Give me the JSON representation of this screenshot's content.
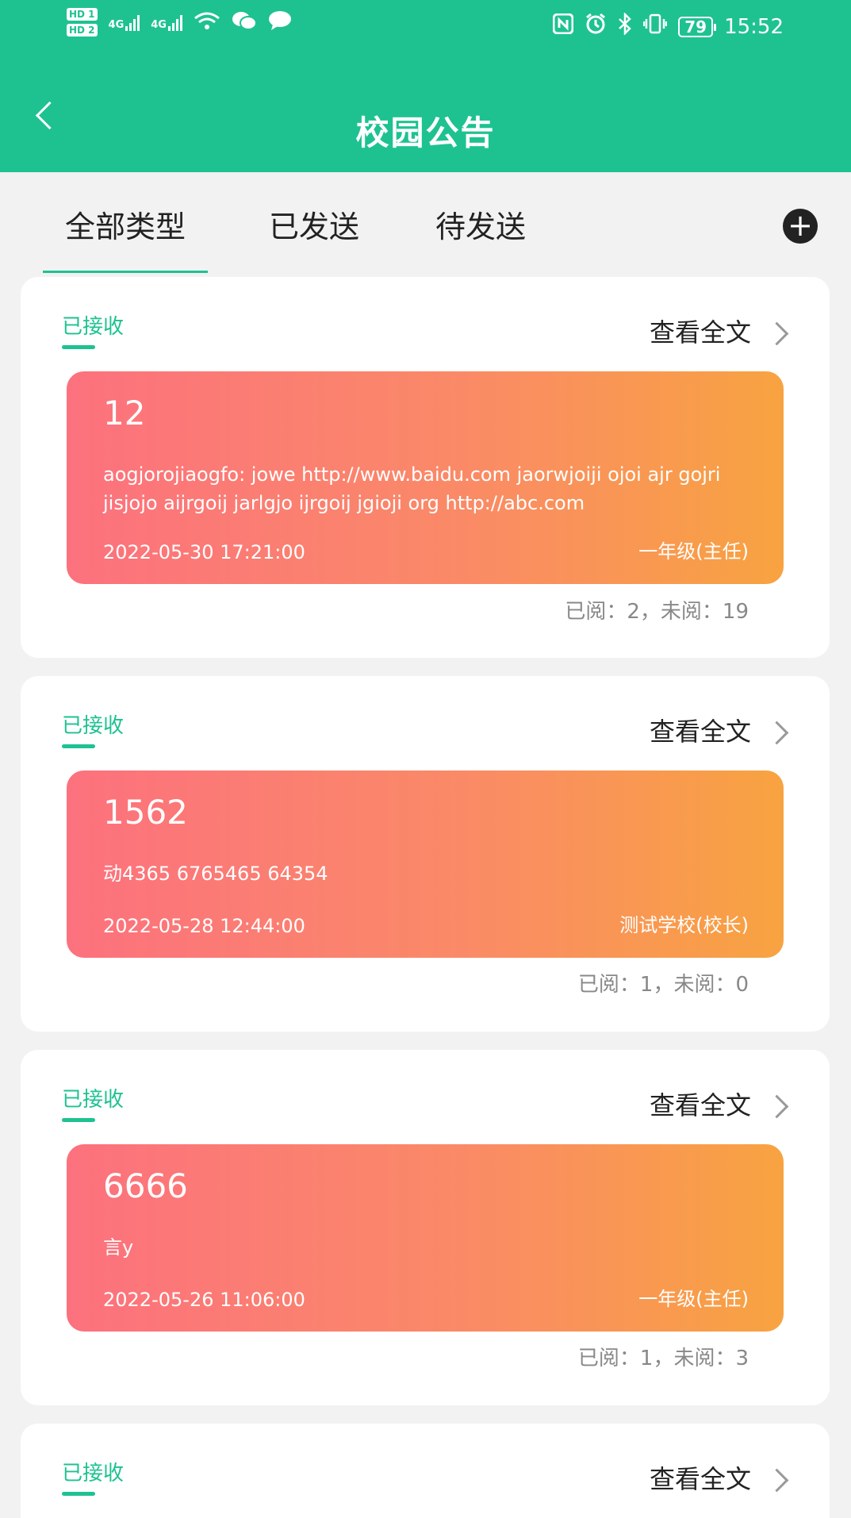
{
  "status_bar": {
    "hd1": "HD 1",
    "hd2": "HD 2",
    "net1": "4G",
    "net2": "4G",
    "battery": "79",
    "time": "15:52"
  },
  "header": {
    "title": "校园公告"
  },
  "tabs": [
    {
      "label": "全部类型",
      "active": true
    },
    {
      "label": "已发送",
      "active": false
    },
    {
      "label": "待发送",
      "active": false
    }
  ],
  "add_label": "+",
  "cards": [
    {
      "status": "已接收",
      "view_all": "查看全文",
      "title": "12",
      "body": "aogjorojiaogfo: jowe http://www.baidu.com jaorwjoiji ojoi ajr gojri jisjojo aijrgoij jarlgjo ijrgoij jgioji org http://abc.com",
      "date": "2022-05-30 17:21:00",
      "sender": "一年级(主任)",
      "read_stats": "已阅：2，未阅：19"
    },
    {
      "status": "已接收",
      "view_all": "查看全文",
      "title": "1562",
      "body": "动4365 6765465 64354",
      "date": "2022-05-28 12:44:00",
      "sender": "测试学校(校长)",
      "read_stats": "已阅：1，未阅：0"
    },
    {
      "status": "已接收",
      "view_all": "查看全文",
      "title": "6666",
      "body": "言y",
      "date": "2022-05-26 11:06:00",
      "sender": "一年级(主任)",
      "read_stats": "已阅：1，未阅：3"
    },
    {
      "status": "已接收",
      "view_all": "查看全文"
    }
  ]
}
